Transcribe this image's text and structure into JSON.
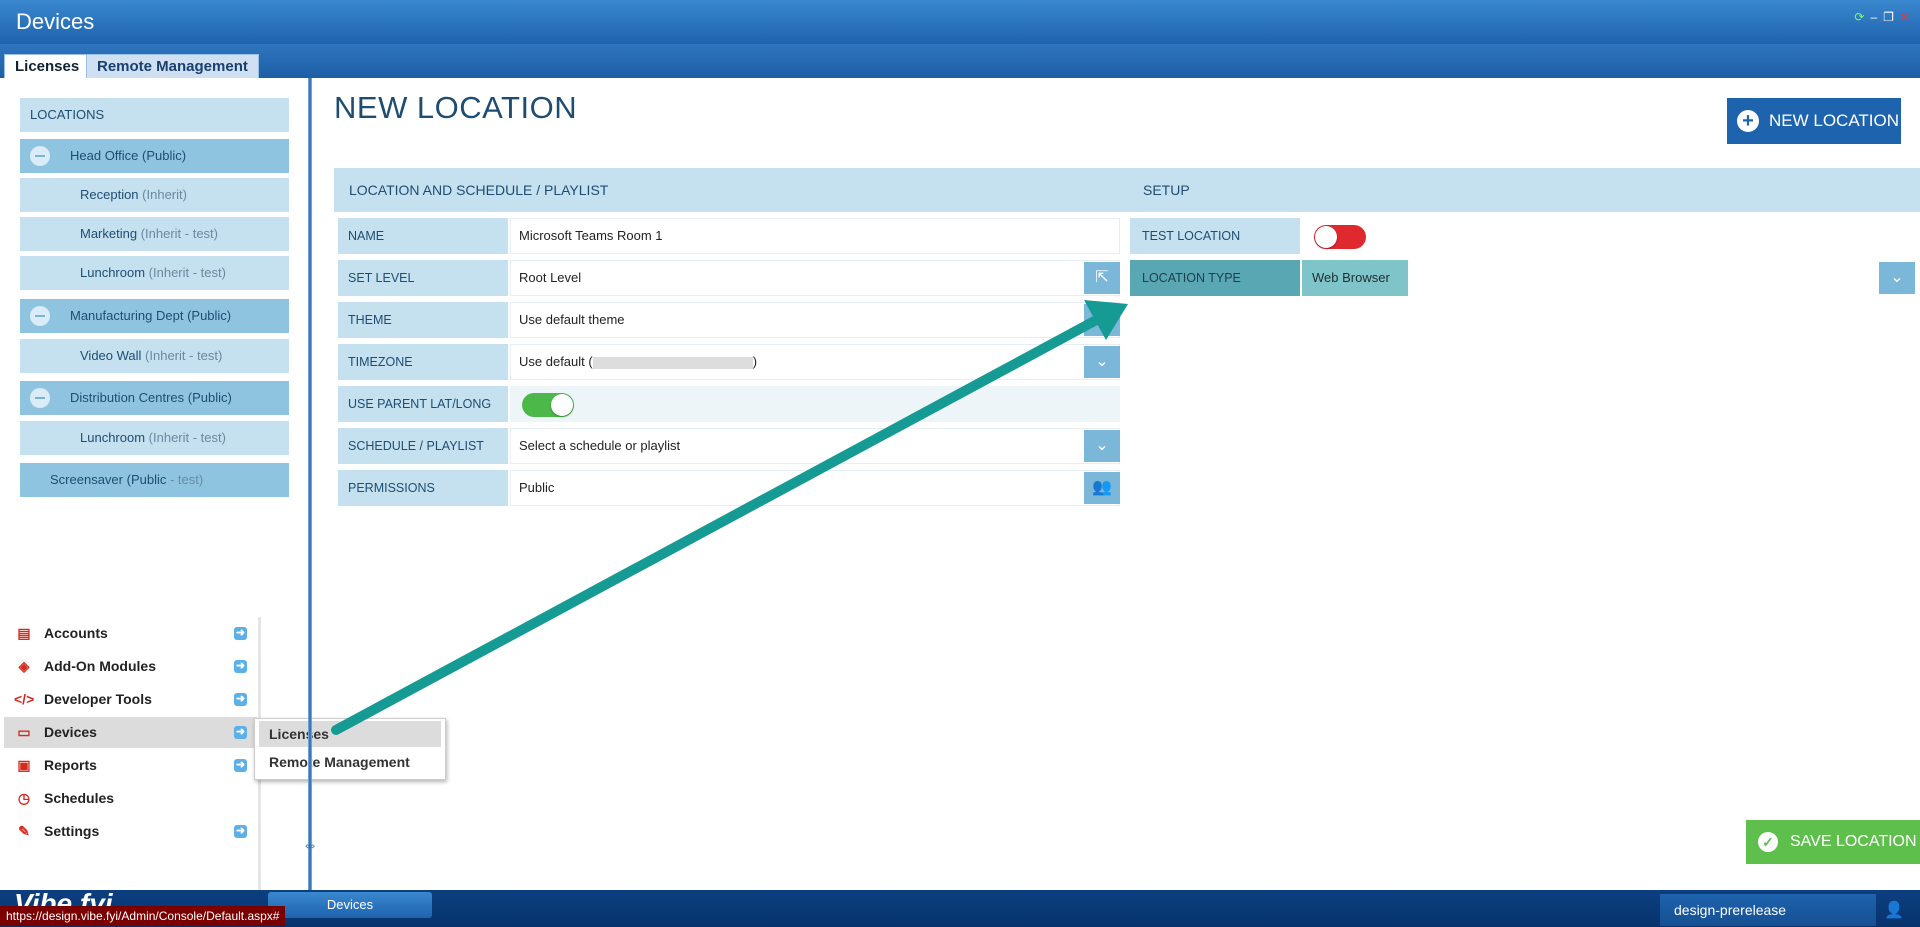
{
  "window": {
    "title": "Devices",
    "controls": [
      "refresh-icon",
      "minimize-icon",
      "restore-icon",
      "close-icon"
    ]
  },
  "tabs": [
    {
      "label": "Licenses",
      "active": true
    },
    {
      "label": "Remote Management",
      "active": false
    }
  ],
  "locations": {
    "header": "LOCATIONS",
    "items": [
      {
        "name": "Head Office (Public)",
        "level": 0,
        "parent": true
      },
      {
        "name": "Reception",
        "suffix": "(Inherit)",
        "level": 1
      },
      {
        "name": "Marketing",
        "suffix": "(Inherit - test)",
        "level": 1
      },
      {
        "name": "Lunchroom",
        "suffix": "(Inherit - test)",
        "level": 1
      },
      {
        "name": "Manufacturing Dept (Public)",
        "level": 0,
        "parent": true
      },
      {
        "name": "Video Wall",
        "suffix": "(Inherit - test)",
        "level": 1
      },
      {
        "name": "Distribution Centres (Public)",
        "level": 0,
        "parent": true
      },
      {
        "name": "Lunchroom",
        "suffix": "(Inherit - test)",
        "level": 1
      },
      {
        "name": "Screensaver",
        "prefix": "(Public",
        "suffix": "- test)",
        "level": 0
      }
    ]
  },
  "menu": [
    {
      "label": "Accounts",
      "icon": "id-card-icon",
      "arrow": true
    },
    {
      "label": "Add-On Modules",
      "icon": "cube-icon",
      "arrow": true
    },
    {
      "label": "Developer Tools",
      "icon": "code-icon",
      "arrow": true
    },
    {
      "label": "Devices",
      "icon": "monitor-icon",
      "arrow": true,
      "active": true
    },
    {
      "label": "Reports",
      "icon": "clipboard-icon",
      "arrow": true
    },
    {
      "label": "Schedules",
      "icon": "clock-icon",
      "arrow": false
    },
    {
      "label": "Settings",
      "icon": "wrench-icon",
      "arrow": true
    }
  ],
  "submenu": {
    "items": [
      "Licenses",
      "Remote Management"
    ],
    "active_index": 0
  },
  "page": {
    "title": "NEW LOCATION",
    "new_button": "NEW LOCATION",
    "save_button": "SAVE LOCATION"
  },
  "location_panel": {
    "header": "LOCATION AND SCHEDULE / PLAYLIST",
    "rows": [
      {
        "label": "NAME",
        "value": "Microsoft Teams Room 1"
      },
      {
        "label": "SET LEVEL",
        "value": "Root Level",
        "button": "share-icon"
      },
      {
        "label": "THEME",
        "value": "Use default theme",
        "button": "chevron-down-icon"
      },
      {
        "label": "TIMEZONE",
        "value_prefix": "Use default (",
        "value_suffix": ")",
        "button": "chevron-down-icon"
      },
      {
        "label": "USE PARENT LAT/LONG",
        "toggle": true
      },
      {
        "label": "SCHEDULE / PLAYLIST",
        "value": "Select a schedule or playlist",
        "button": "chevron-down-icon"
      },
      {
        "label": "PERMISSIONS",
        "value": "Public",
        "button": "users-icon"
      }
    ]
  },
  "setup_panel": {
    "header": "SETUP",
    "rows": [
      {
        "label": "TEST LOCATION",
        "toggle": false
      },
      {
        "label": "LOCATION TYPE",
        "value": "Web Browser",
        "button": "chevron-down-icon"
      }
    ]
  },
  "taskbar": {
    "logo": "Vibe.fyi",
    "active_task": "Devices",
    "environment": "design-prerelease",
    "status_url": "https://design.vibe.fyi/Admin/Console/Default.aspx#"
  },
  "colors": {
    "brand_blue": "#1e63ad",
    "accent_green": "#5fbf4d",
    "toggle_off": "#e0282f",
    "arrow_teal": "#159a94",
    "menu_icon_red": "#d52b1e"
  }
}
